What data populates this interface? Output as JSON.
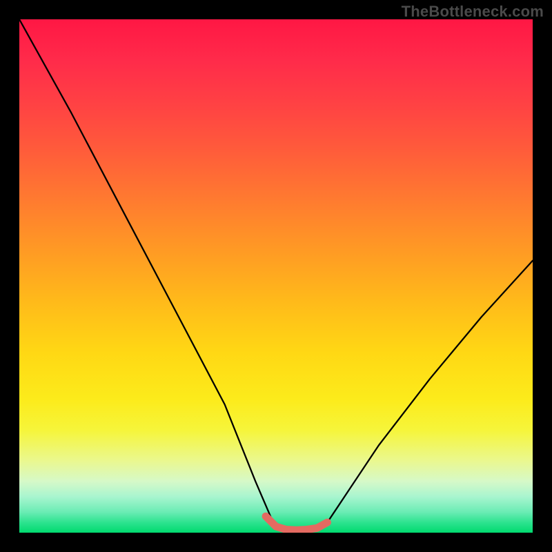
{
  "watermark": {
    "text": "TheBottleneck.com"
  },
  "chart_data": {
    "type": "line",
    "title": "",
    "xlabel": "",
    "ylabel": "",
    "xlim": [
      0,
      100
    ],
    "ylim": [
      0,
      100
    ],
    "series": [
      {
        "name": "bottleneck-curve",
        "x": [
          0,
          10,
          20,
          30,
          40,
          46,
          49,
          50,
          54,
          58,
          60,
          62,
          70,
          80,
          90,
          100
        ],
        "y": [
          100,
          82,
          63,
          44,
          25,
          10,
          3,
          1,
          0.5,
          0.7,
          2,
          5,
          17,
          30,
          42,
          53
        ]
      }
    ],
    "highlight": {
      "name": "optimal-range",
      "x": [
        48,
        50,
        52,
        54,
        56,
        58,
        60
      ],
      "y": [
        3.2,
        1.2,
        0.6,
        0.5,
        0.6,
        0.9,
        2.0
      ]
    },
    "colors": {
      "curve": "#000000",
      "highlight": "#e46a61",
      "gradient_top": "#ff1744",
      "gradient_bottom": "#00da6f"
    }
  }
}
